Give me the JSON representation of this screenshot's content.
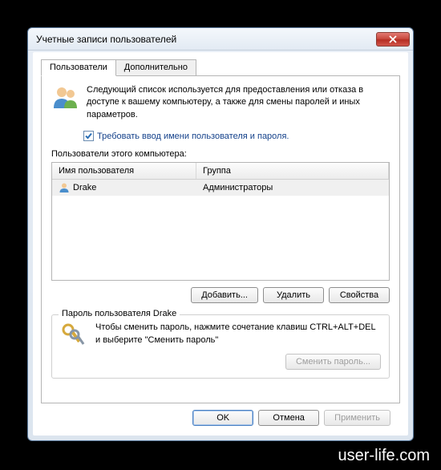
{
  "window": {
    "title": "Учетные записи пользователей"
  },
  "tabs": {
    "users": "Пользователи",
    "advanced": "Дополнительно"
  },
  "info": "Следующий список используется для предоставления или отказа в доступе к вашему компьютеру, а также для смены паролей и иных параметров.",
  "checkbox": {
    "label": "Требовать ввод имени пользователя и пароля.",
    "checked": true
  },
  "list": {
    "label": "Пользователи этого компьютера:",
    "columns": {
      "name": "Имя пользователя",
      "group": "Группа"
    },
    "rows": [
      {
        "name": "Drake",
        "group": "Администраторы",
        "selected": true
      }
    ]
  },
  "buttons": {
    "add": "Добавить...",
    "remove": "Удалить",
    "properties": "Свойства"
  },
  "password_box": {
    "title": "Пароль пользователя Drake",
    "text": "Чтобы сменить пароль, нажмите сочетание клавиш CTRL+ALT+DEL и выберите \"Сменить пароль\"",
    "button": "Сменить пароль..."
  },
  "dialog_buttons": {
    "ok": "OK",
    "cancel": "Отмена",
    "apply": "Применить"
  },
  "watermark": "user-life.com"
}
